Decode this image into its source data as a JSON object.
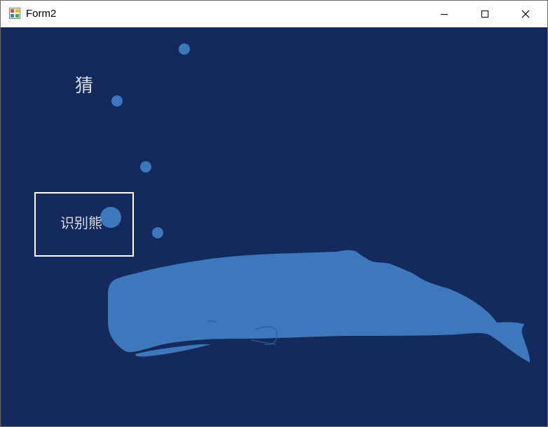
{
  "window": {
    "title": "Form2",
    "buttons": {
      "minimize": "minimize-icon",
      "maximize": "maximize-icon",
      "close": "close-icon"
    }
  },
  "scene": {
    "background_color": "#142a5c",
    "accent_color": "#3d78bd",
    "guess_label": "猜",
    "recognize_label": "识别熊"
  }
}
